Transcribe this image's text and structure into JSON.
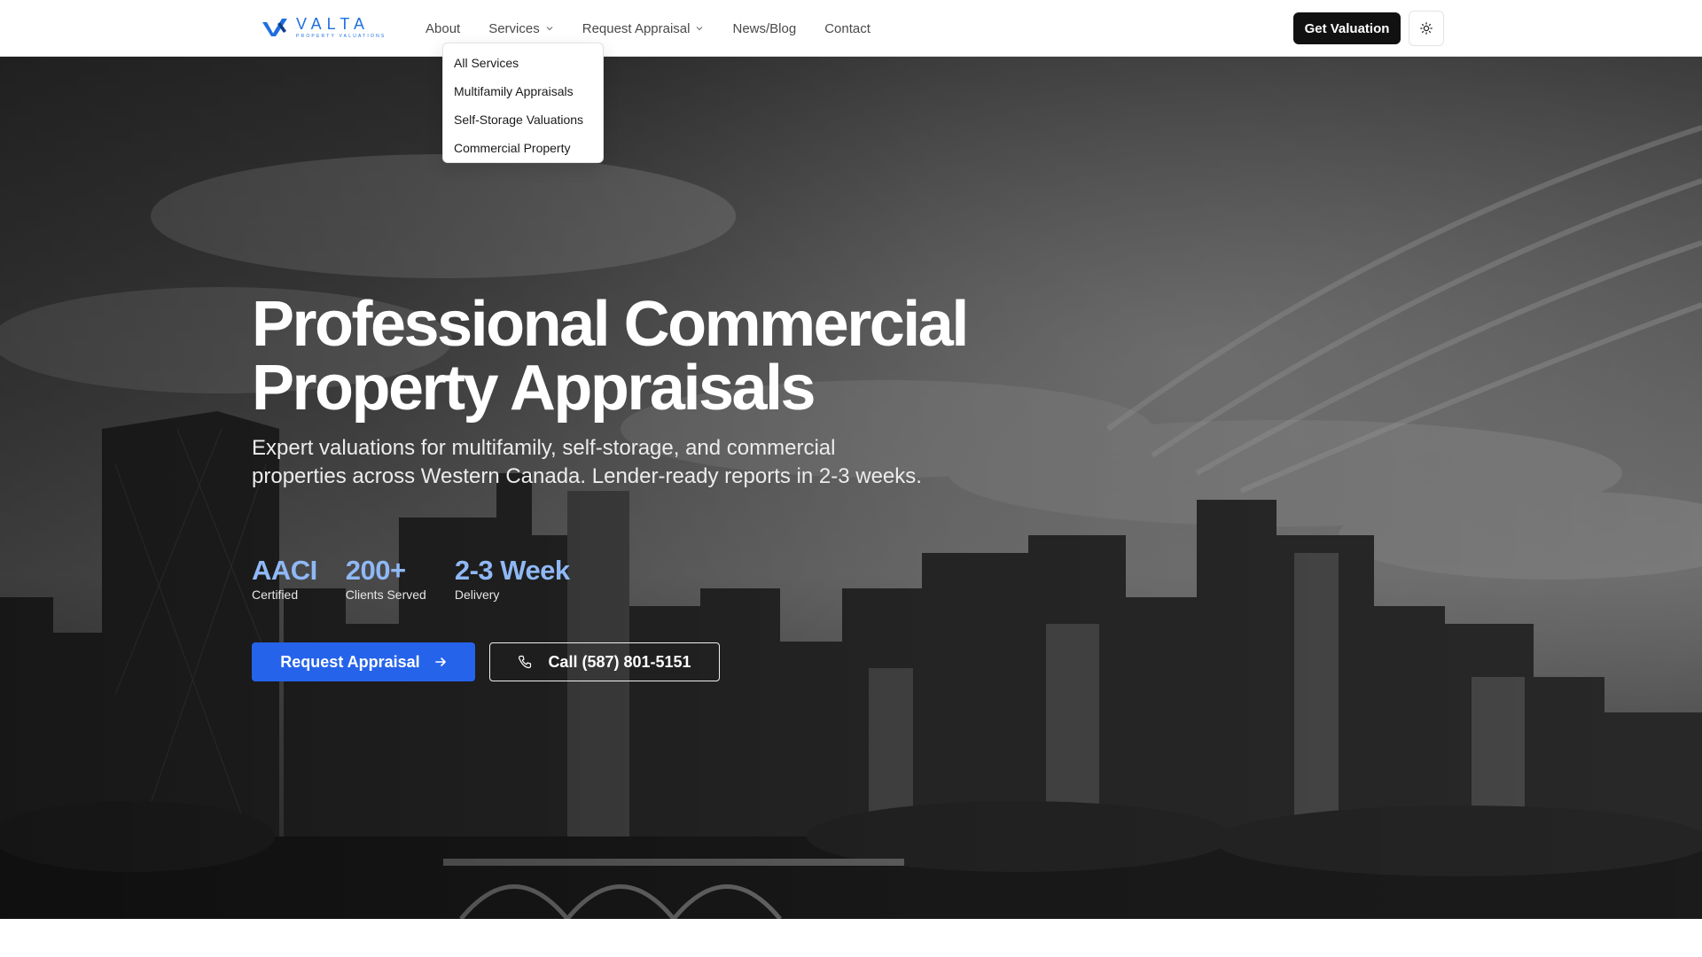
{
  "brand": {
    "name": "VALTA",
    "tagline": "PROPERTY VALUATIONS",
    "color": "#1f6fe0"
  },
  "nav": {
    "items": [
      {
        "label": "About",
        "has_dropdown": false
      },
      {
        "label": "Services",
        "has_dropdown": true
      },
      {
        "label": "Request Appraisal",
        "has_dropdown": true
      },
      {
        "label": "News/Blog",
        "has_dropdown": false
      },
      {
        "label": "Contact",
        "has_dropdown": false
      }
    ],
    "cta_label": "Get Valuation",
    "theme_toggle_icon": "sun-icon"
  },
  "services_dropdown": {
    "items": [
      "All Services",
      "Multifamily Appraisals",
      "Self-Storage Valuations",
      "Commercial Property"
    ]
  },
  "hero": {
    "title_line1": "Professional Commercial",
    "title_line2": "Property Appraisals",
    "subtitle": "Expert valuations for multifamily, self-storage, and commercial properties across Western Canada. Lender-ready reports in 2-3 weeks.",
    "stats": [
      {
        "value": "AACI",
        "label": "Certified"
      },
      {
        "value": "200+",
        "label": "Clients Served"
      },
      {
        "value": "2-3 Week",
        "label": "Delivery"
      }
    ],
    "primary_button": "Request Appraisal",
    "call_button": "Call (587) 801-5151",
    "accent_color": "#2563eb",
    "stat_color": "#8fb8f5"
  }
}
